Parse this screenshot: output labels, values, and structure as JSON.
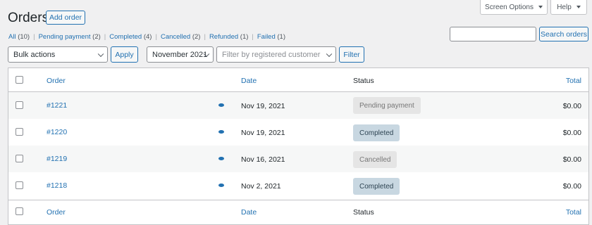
{
  "header": {
    "title": "Orders",
    "add_order": "Add order",
    "screen_options": "Screen Options",
    "help": "Help"
  },
  "filters_status": [
    {
      "label": "All",
      "count": "(10)"
    },
    {
      "label": "Pending payment",
      "count": "(2)"
    },
    {
      "label": "Completed",
      "count": "(4)"
    },
    {
      "label": "Cancelled",
      "count": "(2)"
    },
    {
      "label": "Refunded",
      "count": "(1)"
    },
    {
      "label": "Failed",
      "count": "(1)"
    }
  ],
  "search": {
    "value": "",
    "button": "Search orders"
  },
  "toolbar": {
    "bulk_actions": "Bulk actions",
    "apply": "Apply",
    "month": "November 2021",
    "customer_placeholder": "Filter by registered customer",
    "filter": "Filter"
  },
  "table": {
    "columns": {
      "order": "Order",
      "date": "Date",
      "status": "Status",
      "total": "Total"
    },
    "rows": [
      {
        "order": "#1221",
        "date": "Nov 19, 2021",
        "status": "Pending payment",
        "status_key": "pending",
        "total": "$0.00"
      },
      {
        "order": "#1220",
        "date": "Nov 19, 2021",
        "status": "Completed",
        "status_key": "completed",
        "total": "$0.00"
      },
      {
        "order": "#1219",
        "date": "Nov 16, 2021",
        "status": "Cancelled",
        "status_key": "cancelled",
        "total": "$0.00"
      },
      {
        "order": "#1218",
        "date": "Nov 2, 2021",
        "status": "Completed",
        "status_key": "completed",
        "total": "$0.00"
      }
    ]
  },
  "icons": {
    "preview": "eye-icon",
    "dropdown": "chevron-down-icon",
    "caret": "caret-down-icon"
  },
  "colors": {
    "accent": "#2271b1",
    "background": "#f0f0f1",
    "completed_badge": "#c8d7e1",
    "pending_badge": "#e5e5e5"
  }
}
